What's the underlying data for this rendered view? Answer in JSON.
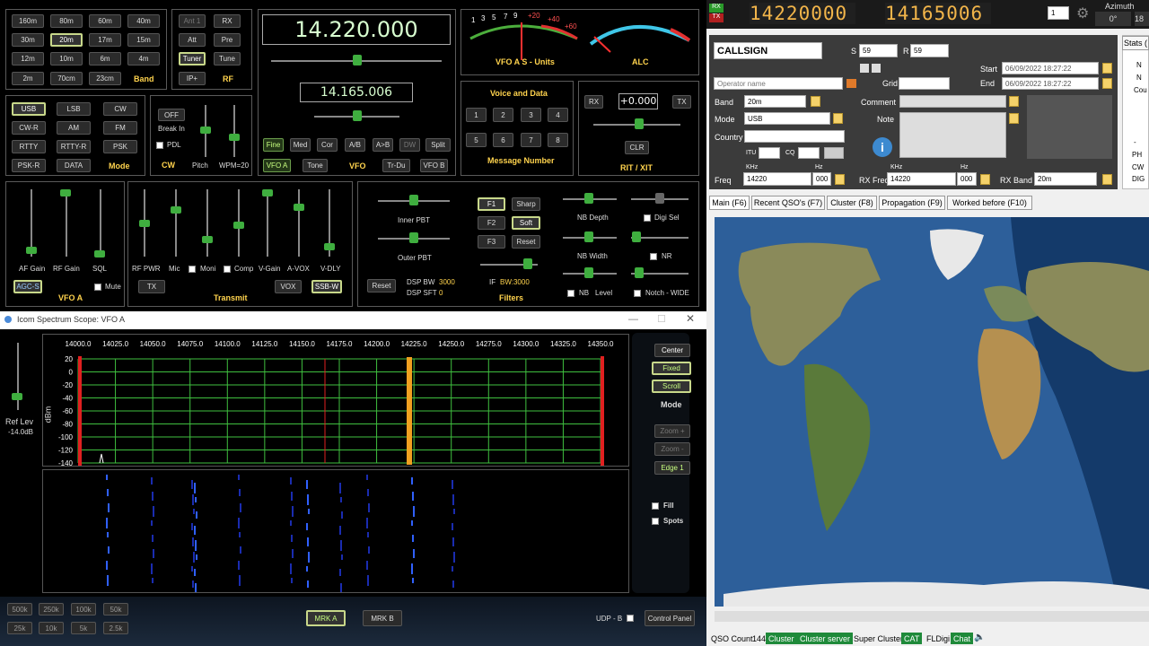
{
  "bands": {
    "row1": [
      "160m",
      "80m",
      "60m",
      "40m"
    ],
    "row2": [
      "30m",
      "20m",
      "17m",
      "15m"
    ],
    "row3": [
      "12m",
      "10m",
      "6m",
      "4m"
    ],
    "row4": [
      "2m",
      "70cm",
      "23cm"
    ],
    "label": "Band"
  },
  "rf": {
    "buttons": [
      "Ant 1",
      "RX",
      "Att",
      "Pre",
      "Tuner",
      "Tune",
      "IP+"
    ],
    "label": "RF"
  },
  "vfo": {
    "main_freq": "14.220.000",
    "sub_freq": "14.165.006",
    "fine": "Fine",
    "med": "Med",
    "cor": "Cor",
    "ab": "A/B",
    "atob": "A>B",
    "dw": "DW",
    "split": "Split",
    "vfoa": "VFO A",
    "tone": "Tone",
    "label": "VFO",
    "trdu": "Tr-Du",
    "vfob": "VFO B"
  },
  "meters": {
    "s_label": "VFO A S - Units",
    "alc_label": "ALC",
    "s_scale": [
      "1",
      "3",
      "5",
      "7",
      "9",
      "+20",
      "+40",
      "+60"
    ]
  },
  "voice": {
    "title": "Voice and Data",
    "buttons": [
      "1",
      "2",
      "3",
      "4",
      "5",
      "6",
      "7",
      "8"
    ],
    "footer": "Message Number"
  },
  "rit": {
    "rx": "RX",
    "offset": "+0.000",
    "tx": "TX",
    "clr": "CLR",
    "label": "RIT / XIT"
  },
  "mode": {
    "buttons": [
      "USB",
      "LSB",
      "CW",
      "CW-R",
      "AM",
      "FM",
      "RTTY",
      "RTTY-R",
      "PSK",
      "PSK-R",
      "DATA"
    ],
    "label": "Mode"
  },
  "cw": {
    "off": "OFF",
    "breakin": "Break In",
    "pdl": "PDL",
    "label": "CW",
    "pitch": "Pitch",
    "wpm": "WPM=20"
  },
  "vfoa_panel": {
    "labels": [
      "AF Gain",
      "RF Gain",
      "SQL"
    ],
    "agcs": "AGC-S",
    "mute": "Mute",
    "title": "VFO A"
  },
  "transmit": {
    "labels": [
      "RF PWR",
      "Mic",
      "Moni",
      "Comp",
      "V-Gain",
      "A-VOX",
      "V-DLY"
    ],
    "tx": "TX",
    "vox": "VOX",
    "ssbw": "SSB-W",
    "title": "Transmit"
  },
  "filters": {
    "inner": "Inner PBT",
    "outer": "Outer PBT",
    "reset": "Reset",
    "dsp_bw": "DSP BW",
    "dsp_bw_val": "3000",
    "dsp_sft": "DSP SFT",
    "dsp_sft_val": "0",
    "f1": "F1",
    "f2": "F2",
    "f3": "F3",
    "sharp": "Sharp",
    "soft": "Soft",
    "freset": "Reset",
    "if_bw": "IF",
    "if_bw_val": "BW:3000",
    "title": "Filters",
    "nbdepth": "NB Depth",
    "digisel": "Digi Sel",
    "nbwidth": "NB Width",
    "nr": "NR",
    "nb": "NB",
    "level": "Level",
    "notch": "Notch - WIDE"
  },
  "scope": {
    "title": "Icom Spectrum Scope: VFO A",
    "ref_label": "Ref Lev",
    "ref_val": "-14.0dB",
    "x_ticks": [
      "14000.0",
      "14025.0",
      "14050.0",
      "14075.0",
      "14100.0",
      "14125.0",
      "14150.0",
      "14175.0",
      "14200.0",
      "14225.0",
      "14250.0",
      "14275.0",
      "14300.0",
      "14325.0",
      "14350.0"
    ],
    "y_ticks": [
      "20",
      "0",
      "-20",
      "-40",
      "-60",
      "-80",
      "-100",
      "-120",
      "-140"
    ],
    "ylabel": "dBm",
    "center": "Center",
    "fixed": "Fixed",
    "scroll": "Scroll",
    "mode": "Mode",
    "zoomp": "Zoom +",
    "zoomm": "Zoom -",
    "edge": "Edge 1",
    "fill": "Fill",
    "spots": "Spots",
    "spans": [
      "500k",
      "250k",
      "100k",
      "50k",
      "25k",
      "10k",
      "5k",
      "2.5k"
    ],
    "mrka": "MRK A",
    "mrkb": "MRK B",
    "udp": "UDP - B",
    "control": "Control Panel"
  },
  "top": {
    "rx": "RX",
    "tx": "TX",
    "freq_a": "14220000",
    "freq_b": "14165006",
    "azimuth_label": "Azimuth",
    "azimuth_val": "0°",
    "spin": "1",
    "az_right": "18"
  },
  "qso": {
    "callsign": "CALLSIGN",
    "s": "S",
    "s_val": "59",
    "r": "R",
    "r_val": "59",
    "operator": "Operator name",
    "grid": "Grid",
    "start": "Start",
    "start_val": "06/09/2022 18:27:22",
    "end": "End",
    "end_val": "06/09/2022 18:27:22",
    "band": "Band",
    "band_val": "20m",
    "mode": "Mode",
    "mode_val": "USB",
    "country": "Country",
    "itu": "ITU",
    "cq": "CQ",
    "comment": "Comment",
    "note": "Note",
    "freq": "Freq",
    "khz": "KHz",
    "hz": "Hz",
    "freq_khz": "14220",
    "freq_hz": "000",
    "rxfreq": "RX Freq",
    "rxfreq_khz": "14220",
    "rxfreq_hz": "000",
    "rxband": "RX Band",
    "rxband_val": "20m",
    "stats": "Stats (",
    "side": [
      "N",
      "N",
      "Cou",
      "-",
      "PH",
      "CW",
      "DIG"
    ]
  },
  "tabs": [
    "Main (F6)",
    "Recent QSO's (F7)",
    "Cluster (F8)",
    "Propagation (F9)",
    "Worked before (F10)"
  ],
  "status": {
    "qso_count_label": "QSO Count",
    "qso_count": "144",
    "items": [
      "Cluster",
      "Cluster server",
      "Super Cluster",
      "CAT",
      "FLDigi",
      "Chat"
    ]
  }
}
